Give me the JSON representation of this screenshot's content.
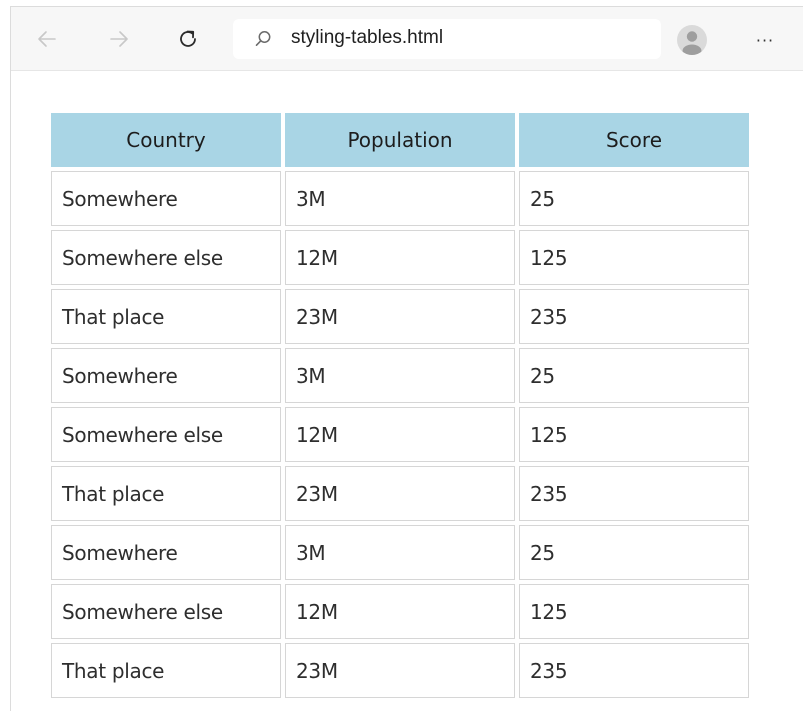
{
  "browser": {
    "url": "styling-tables.html",
    "icons": {
      "back": "arrow-left-icon",
      "forward": "arrow-right-icon",
      "reload": "reload-icon",
      "search": "search-icon",
      "profile": "profile-avatar-icon",
      "more": "more-horizontal-icon"
    },
    "more_label": "···"
  },
  "table": {
    "header_color": "#a9d5e5",
    "columns": [
      "Country",
      "Population",
      "Score"
    ],
    "rows": [
      [
        "Somewhere",
        "3M",
        "25"
      ],
      [
        "Somewhere else",
        "12M",
        "125"
      ],
      [
        "That place",
        "23M",
        "235"
      ],
      [
        "Somewhere",
        "3M",
        "25"
      ],
      [
        "Somewhere else",
        "12M",
        "125"
      ],
      [
        "That place",
        "23M",
        "235"
      ],
      [
        "Somewhere",
        "3M",
        "25"
      ],
      [
        "Somewhere else",
        "12M",
        "125"
      ],
      [
        "That place",
        "23M",
        "235"
      ]
    ]
  }
}
